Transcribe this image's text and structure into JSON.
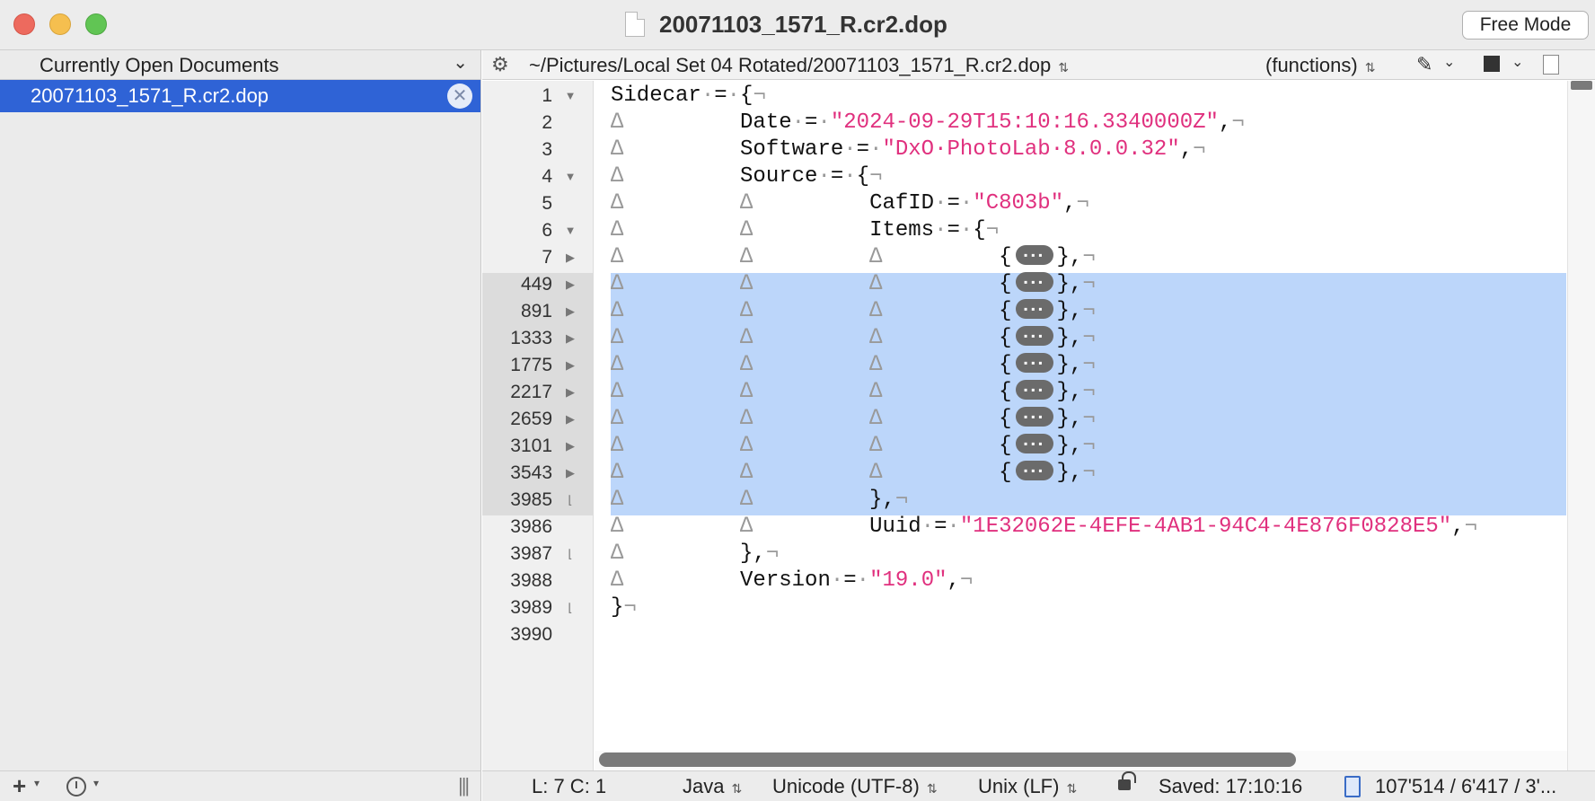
{
  "window": {
    "title": "20071103_1571_R.cr2.dop",
    "free_mode_label": "Free Mode"
  },
  "sidebar": {
    "header_label": "Currently Open Documents",
    "documents": [
      {
        "name": "20071103_1571_R.cr2.dop",
        "selected": true
      }
    ]
  },
  "toolbar": {
    "path": "~/Pictures/Local Set 04 Rotated/20071103_1571_R.cr2.dop",
    "functions_label": "(functions)"
  },
  "editor": {
    "line_numbers": [
      "1",
      "2",
      "3",
      "4",
      "5",
      "6",
      "7",
      "449",
      "891",
      "1333",
      "1775",
      "2217",
      "2659",
      "3101",
      "3543",
      "3985",
      "3986",
      "3987",
      "3988",
      "3989",
      "3990"
    ],
    "lines": {
      "l1_key": "Sidecar",
      "l2_key": "Date",
      "l2_val": "\"2024-09-29T15:10:16.3340000Z\"",
      "l3_key": "Software",
      "l3_val": "\"DxO·PhotoLab·8.0.0.32\"",
      "l4_key": "Source",
      "l5_key": "CafID",
      "l5_val": "\"C803b\"",
      "l6_key": "Items",
      "l17_key": "Uuid",
      "l17_val": "\"1E32062E-4EFE-4AB1-94C4-4E876F0828E5\"",
      "l19_key": "Version",
      "l19_val": "\"19.0\""
    }
  },
  "status": {
    "position": "L: 7 C: 1",
    "language": "Java",
    "encoding": "Unicode (UTF-8)",
    "line_endings": "Unix (LF)",
    "saved": "Saved: 17:10:16",
    "stats": "107'514 / 6'417 / 3'..."
  },
  "colors": {
    "selection": "#bcd6fa",
    "string": "#e0307e",
    "sidebar_selected": "#2f63d6"
  }
}
